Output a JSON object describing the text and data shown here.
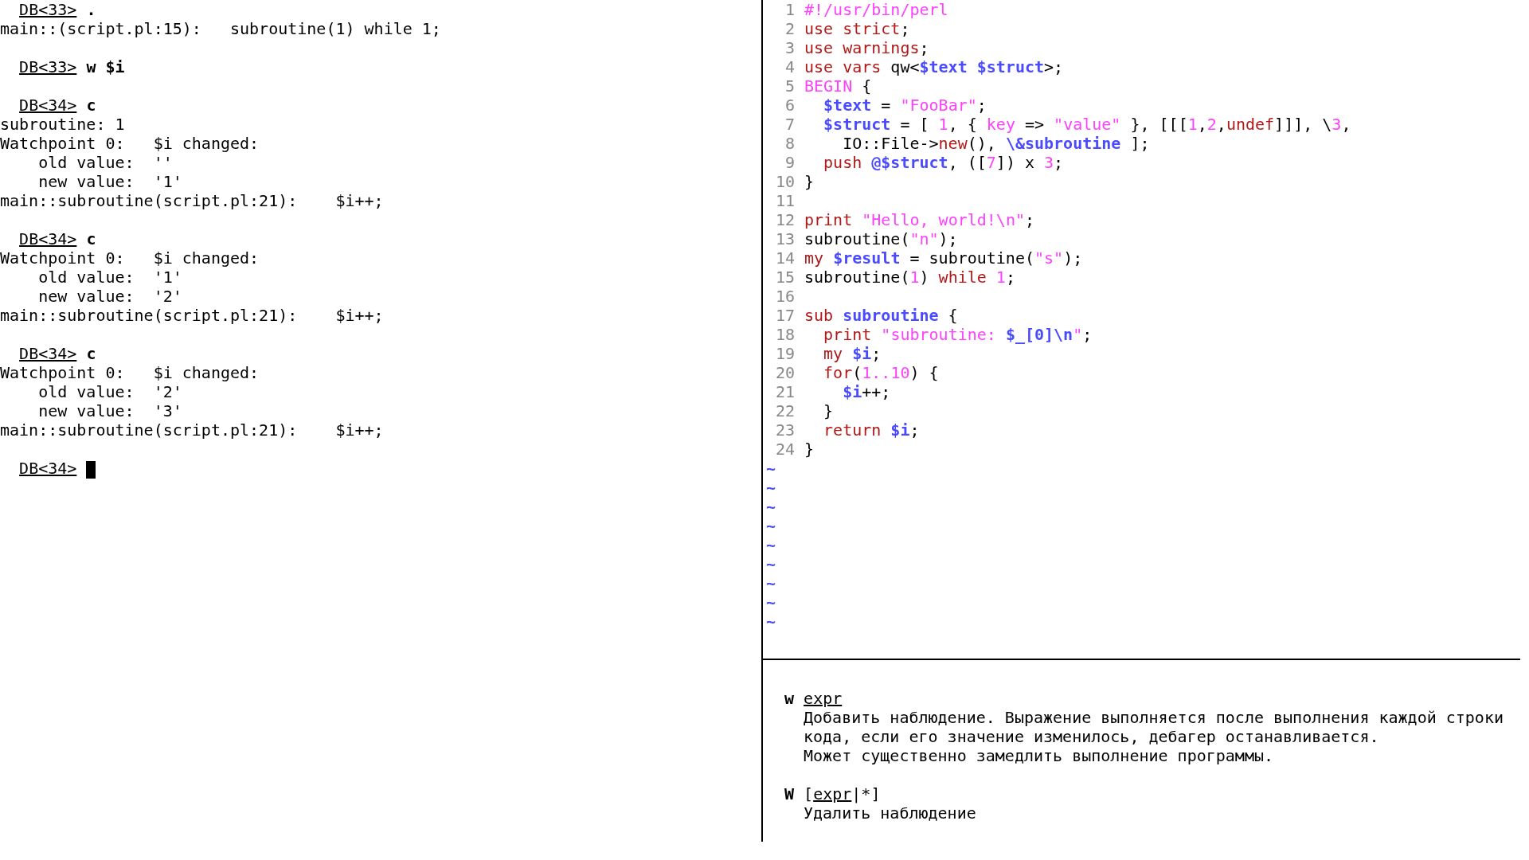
{
  "terminal": {
    "lines": [
      {
        "kind": "prompt",
        "prompt": "DB<33>",
        "command": ".",
        "cursor": false
      },
      {
        "kind": "output",
        "text": "main::(script.pl:15):   subroutine(1) while 1;"
      },
      {
        "kind": "blank"
      },
      {
        "kind": "prompt",
        "prompt": "DB<33>",
        "command": "w $i",
        "cursor": false
      },
      {
        "kind": "blank"
      },
      {
        "kind": "prompt",
        "prompt": "DB<34>",
        "command": "c",
        "cursor": false
      },
      {
        "kind": "output",
        "text": "subroutine: 1"
      },
      {
        "kind": "output",
        "text": "Watchpoint 0:   $i changed:"
      },
      {
        "kind": "output",
        "text": "    old value:  ''"
      },
      {
        "kind": "output",
        "text": "    new value:  '1'"
      },
      {
        "kind": "output",
        "text": "main::subroutine(script.pl:21):    $i++;"
      },
      {
        "kind": "blank"
      },
      {
        "kind": "prompt",
        "prompt": "DB<34>",
        "command": "c",
        "cursor": false
      },
      {
        "kind": "output",
        "text": "Watchpoint 0:   $i changed:"
      },
      {
        "kind": "output",
        "text": "    old value:  '1'"
      },
      {
        "kind": "output",
        "text": "    new value:  '2'"
      },
      {
        "kind": "output",
        "text": "main::subroutine(script.pl:21):    $i++;"
      },
      {
        "kind": "blank"
      },
      {
        "kind": "prompt",
        "prompt": "DB<34>",
        "command": "c",
        "cursor": false
      },
      {
        "kind": "output",
        "text": "Watchpoint 0:   $i changed:"
      },
      {
        "kind": "output",
        "text": "    old value:  '2'"
      },
      {
        "kind": "output",
        "text": "    new value:  '3'"
      },
      {
        "kind": "output",
        "text": "main::subroutine(script.pl:21):    $i++;"
      },
      {
        "kind": "blank"
      },
      {
        "kind": "prompt",
        "prompt": "DB<34>",
        "cursor": true
      }
    ]
  },
  "editor": {
    "lines": [
      {
        "number": "1",
        "tokens": [
          {
            "text": "#!/usr/bin/perl",
            "kind": "comment"
          }
        ]
      },
      {
        "number": "2",
        "tokens": [
          {
            "text": "use strict",
            "kind": "keyword"
          },
          {
            "text": ";",
            "kind": "plain"
          }
        ]
      },
      {
        "number": "3",
        "tokens": [
          {
            "text": "use warnings",
            "kind": "keyword"
          },
          {
            "text": ";",
            "kind": "plain"
          }
        ]
      },
      {
        "number": "4",
        "tokens": [
          {
            "text": "use vars",
            "kind": "keyword"
          },
          {
            "text": " qw<",
            "kind": "plain"
          },
          {
            "text": "$text $struct",
            "kind": "variable"
          },
          {
            "text": ">;",
            "kind": "plain"
          }
        ]
      },
      {
        "number": "5",
        "tokens": [
          {
            "text": "BEGIN",
            "kind": "comment"
          },
          {
            "text": " {",
            "kind": "plain"
          }
        ]
      },
      {
        "number": "6",
        "tokens": [
          {
            "text": "  $text",
            "kind": "variable"
          },
          {
            "text": " = ",
            "kind": "plain"
          },
          {
            "text": "\"FooBar\"",
            "kind": "constant"
          },
          {
            "text": ";",
            "kind": "plain"
          }
        ]
      },
      {
        "number": "7",
        "tokens": [
          {
            "text": "  $struct",
            "kind": "variable"
          },
          {
            "text": " = [ ",
            "kind": "plain"
          },
          {
            "text": "1",
            "kind": "constant"
          },
          {
            "text": ", { ",
            "kind": "plain"
          },
          {
            "text": "key",
            "kind": "constant"
          },
          {
            "text": " => ",
            "kind": "plain"
          },
          {
            "text": "\"value\"",
            "kind": "constant"
          },
          {
            "text": " }, [[[",
            "kind": "plain"
          },
          {
            "text": "1",
            "kind": "constant"
          },
          {
            "text": ",",
            "kind": "plain"
          },
          {
            "text": "2",
            "kind": "constant"
          },
          {
            "text": ",",
            "kind": "plain"
          },
          {
            "text": "undef",
            "kind": "keyword"
          },
          {
            "text": "]]], \\",
            "kind": "plain"
          },
          {
            "text": "3",
            "kind": "constant"
          },
          {
            "text": ",",
            "kind": "plain"
          }
        ]
      },
      {
        "number": "8",
        "tokens": [
          {
            "text": "    IO::File->",
            "kind": "plain"
          },
          {
            "text": "new",
            "kind": "keyword"
          },
          {
            "text": "(), ",
            "kind": "plain"
          },
          {
            "text": "\\&subroutine",
            "kind": "variable"
          },
          {
            "text": " ];",
            "kind": "plain"
          }
        ]
      },
      {
        "number": "9",
        "tokens": [
          {
            "text": "  push",
            "kind": "keyword"
          },
          {
            "text": " @$struct",
            "kind": "variable"
          },
          {
            "text": ", ([",
            "kind": "plain"
          },
          {
            "text": "7",
            "kind": "constant"
          },
          {
            "text": "]) x ",
            "kind": "plain"
          },
          {
            "text": "3",
            "kind": "constant"
          },
          {
            "text": ";",
            "kind": "plain"
          }
        ]
      },
      {
        "number": "10",
        "tokens": [
          {
            "text": "}",
            "kind": "plain"
          }
        ]
      },
      {
        "number": "11"
      },
      {
        "number": "12",
        "tokens": [
          {
            "text": "print",
            "kind": "keyword"
          },
          {
            "text": " \"Hello, world!\\n\"",
            "kind": "constant"
          },
          {
            "text": ";",
            "kind": "plain"
          }
        ]
      },
      {
        "number": "13",
        "tokens": [
          {
            "text": "subroutine(",
            "kind": "plain"
          },
          {
            "text": "\"n\"",
            "kind": "constant"
          },
          {
            "text": ");",
            "kind": "plain"
          }
        ]
      },
      {
        "number": "14",
        "tokens": [
          {
            "text": "my",
            "kind": "keyword"
          },
          {
            "text": " $result",
            "kind": "variable"
          },
          {
            "text": " = subroutine(",
            "kind": "plain"
          },
          {
            "text": "\"s\"",
            "kind": "constant"
          },
          {
            "text": ");",
            "kind": "plain"
          }
        ]
      },
      {
        "number": "15",
        "tokens": [
          {
            "text": "subroutine(",
            "kind": "plain"
          },
          {
            "text": "1",
            "kind": "constant"
          },
          {
            "text": ") ",
            "kind": "plain"
          },
          {
            "text": "while",
            "kind": "keyword"
          },
          {
            "text": " 1",
            "kind": "constant"
          },
          {
            "text": ";",
            "kind": "plain"
          }
        ]
      },
      {
        "number": "16"
      },
      {
        "number": "17",
        "tokens": [
          {
            "text": "sub",
            "kind": "keyword"
          },
          {
            "text": " subroutine",
            "kind": "variable"
          },
          {
            "text": " {",
            "kind": "plain"
          }
        ]
      },
      {
        "number": "18",
        "tokens": [
          {
            "text": "  print",
            "kind": "keyword"
          },
          {
            "text": " \"subroutine: ",
            "kind": "constant"
          },
          {
            "text": "$_[0]\\n",
            "kind": "variable"
          },
          {
            "text": "\"",
            "kind": "constant"
          },
          {
            "text": ";",
            "kind": "plain"
          }
        ]
      },
      {
        "number": "19",
        "tokens": [
          {
            "text": "  my",
            "kind": "keyword"
          },
          {
            "text": " $i",
            "kind": "variable"
          },
          {
            "text": ";",
            "kind": "plain"
          }
        ]
      },
      {
        "number": "20",
        "tokens": [
          {
            "text": "  for",
            "kind": "keyword"
          },
          {
            "text": "(",
            "kind": "plain"
          },
          {
            "text": "1..10",
            "kind": "constant"
          },
          {
            "text": ") {",
            "kind": "plain"
          }
        ]
      },
      {
        "number": "21",
        "tokens": [
          {
            "text": "    $i",
            "kind": "variable"
          },
          {
            "text": "++;",
            "kind": "plain"
          }
        ]
      },
      {
        "number": "22",
        "tokens": [
          {
            "text": "  }",
            "kind": "plain"
          }
        ]
      },
      {
        "number": "23",
        "tokens": [
          {
            "text": "  return",
            "kind": "keyword"
          },
          {
            "text": " $i",
            "kind": "variable"
          },
          {
            "text": ";",
            "kind": "plain"
          }
        ]
      },
      {
        "number": "24",
        "tokens": [
          {
            "text": "}",
            "kind": "plain"
          }
        ]
      }
    ],
    "empty_markers": [
      "~",
      "~",
      "~",
      "~",
      "~",
      "~",
      "~",
      "~",
      "~"
    ]
  },
  "help": {
    "entries": [
      {
        "command": "w",
        "args": [
          {
            "text": "expr",
            "kind": "param"
          }
        ],
        "description": [
          "Добавить наблюдение. Выражение выполняется после выполнения каждой строки",
          "кода, если его значение изменилось, дебагер останавливается.",
          "Может существенно замедлить выполнение программы."
        ]
      },
      {
        "command": "W",
        "args": [
          {
            "text": "[",
            "kind": "plain"
          },
          {
            "text": "expr",
            "kind": "param"
          },
          {
            "text": "|*]",
            "kind": "plain"
          }
        ],
        "description": [
          "Удалить наблюдение"
        ]
      }
    ]
  }
}
